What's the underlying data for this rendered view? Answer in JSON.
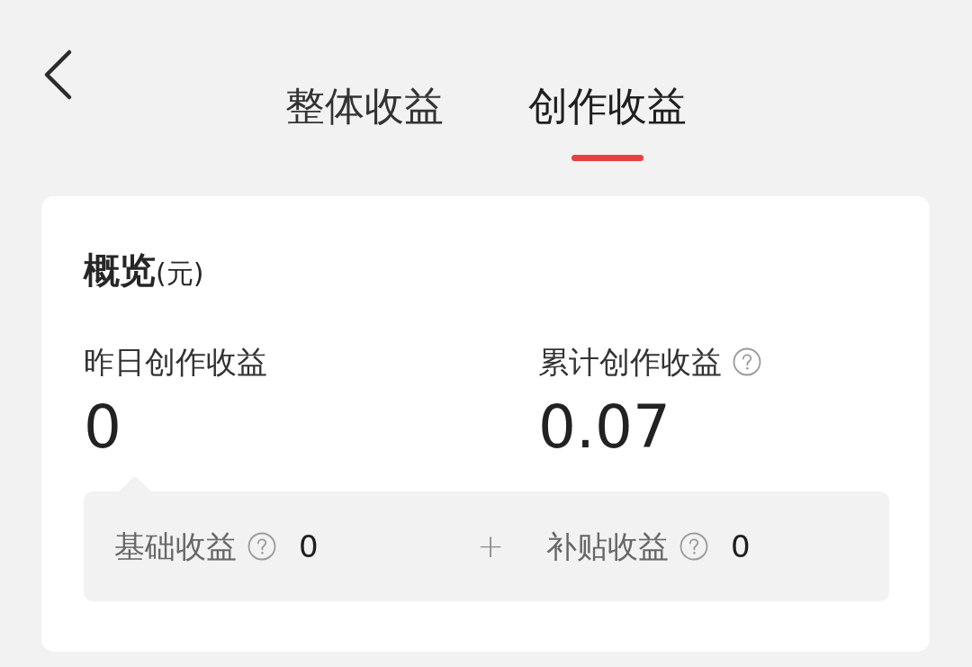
{
  "tabs": [
    {
      "label": "整体收益",
      "selected": false
    },
    {
      "label": "创作收益",
      "selected": true
    }
  ],
  "overview": {
    "title": "**概览**(元)",
    "stats": [
      {
        "label": "昨日创作收益",
        "help": false,
        "value": "0"
      },
      {
        "label": "累计创作收益",
        "help": true,
        "value": "0.07"
      }
    ],
    "breakdown": {
      "items": [
        {
          "label": "基础收益",
          "help": true,
          "value": "0"
        },
        {
          "label": "补贴收益",
          "help": true,
          "value": "0"
        }
      ],
      "operator": "+"
    }
  }
}
